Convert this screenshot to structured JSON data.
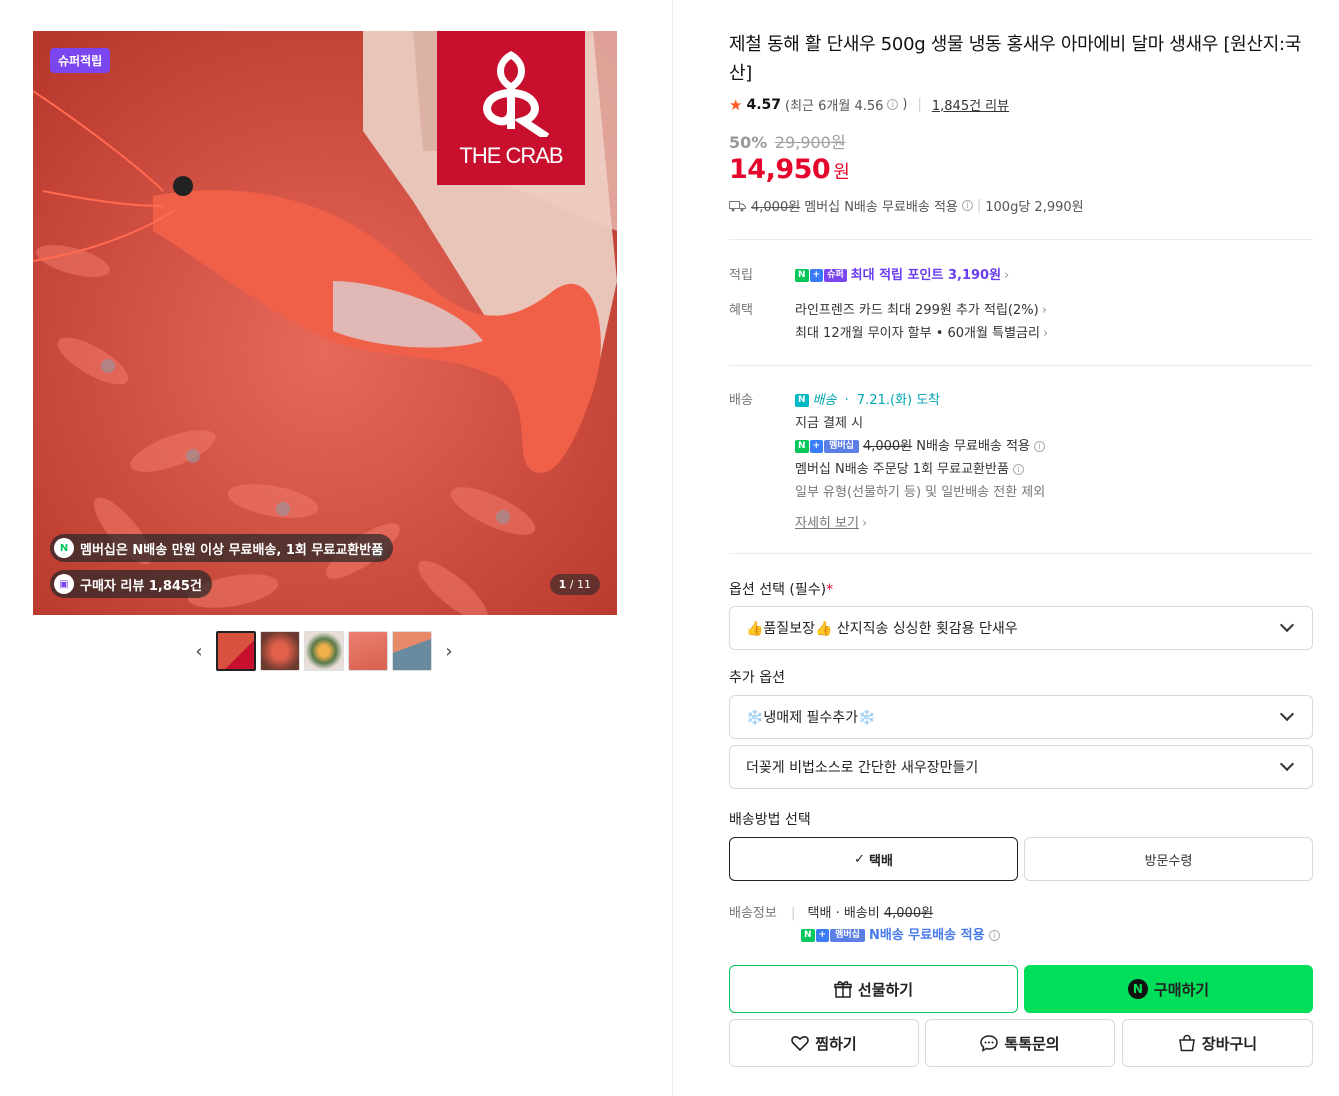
{
  "gallery": {
    "badge": "슈퍼적립",
    "brand_logo_text": "THE CRAB",
    "promo_membership": "멤버십은 N배송 만원 이상 무료배송, 1회 무료교환반품",
    "promo_reviews": "구매자 리뷰 1,845건",
    "counter_current": "1",
    "counter_total": "/ 11",
    "prev_arrow": "‹",
    "next_arrow": "›"
  },
  "product": {
    "title": "제철 동해 활 단새우 500g 생물 냉동 홍새우 아마에비 달마 생새우 [원산지:국산]",
    "rating": "4.57",
    "rating_recent": "(최근 6개월 4.56",
    "rating_recent_close": ")",
    "review_count": "1,845건 리뷰",
    "discount_pct": "50%",
    "original_price": "29,900원",
    "sale_price": "14,950",
    "currency": "원",
    "ship_fee_old": "4,000원",
    "ship_text": "멤버십 N배송 무료배송 적용",
    "unit_price": "100g당 2,990원"
  },
  "benefits": {
    "points_label": "적립",
    "points_tag_n": "N",
    "points_tag_plus": "+",
    "points_tag_super": "슈퍼",
    "points_text": "최대 적립 포인트 3,190원",
    "benefit_label": "혜택",
    "benefit_line1": "라인프렌즈 카드 최대 299원 추가 적립(2%)",
    "benefit_line2": "최대 12개월 무이자 할부 • 60개월 특별금리"
  },
  "delivery": {
    "label": "배송",
    "nship": "배송",
    "arrival": "7.21.(화) 도착",
    "line1": "지금 결제 시",
    "member_tag": "멤버십",
    "fee_old": "4,000원",
    "line2_rest": "N배송 무료배송 적용",
    "line3": "멤버십 N배송 주문당 1회 무료교환반품",
    "line4": "일부 유형(선물하기 등) 및 일반배송 전환 제외",
    "more": "자세히 보기"
  },
  "options": {
    "required_title": "옵션 선택 (필수)",
    "required_mark": "*",
    "required_value": "👍품질보장👍 산지직송 싱싱한 횟감용 단새우",
    "extra_title": "추가 옵션",
    "extra1": "❄️냉매제 필수추가❄️",
    "extra2": "더꽂게 비법소스로 간단한 새우장만들기",
    "method_title": "배송방법 선택",
    "method_selected": "택배",
    "method_other": "방문수령",
    "info_label": "배송정보",
    "info_text": "택배 · 배송비",
    "info_fee": "4,000원",
    "info_member": "멤버십",
    "info_free": "N배송 무료배송 적용"
  },
  "actions": {
    "gift": "선물하기",
    "buy": "구매하기",
    "wish": "찜하기",
    "talk": "톡톡문의",
    "cart": "장바구니"
  },
  "colors": {
    "price_red": "#e5062c",
    "naver_green": "#03c75a",
    "buy_green": "#00de5a",
    "super_purple": "#7b45f0",
    "logo_red": "#c8102e"
  }
}
